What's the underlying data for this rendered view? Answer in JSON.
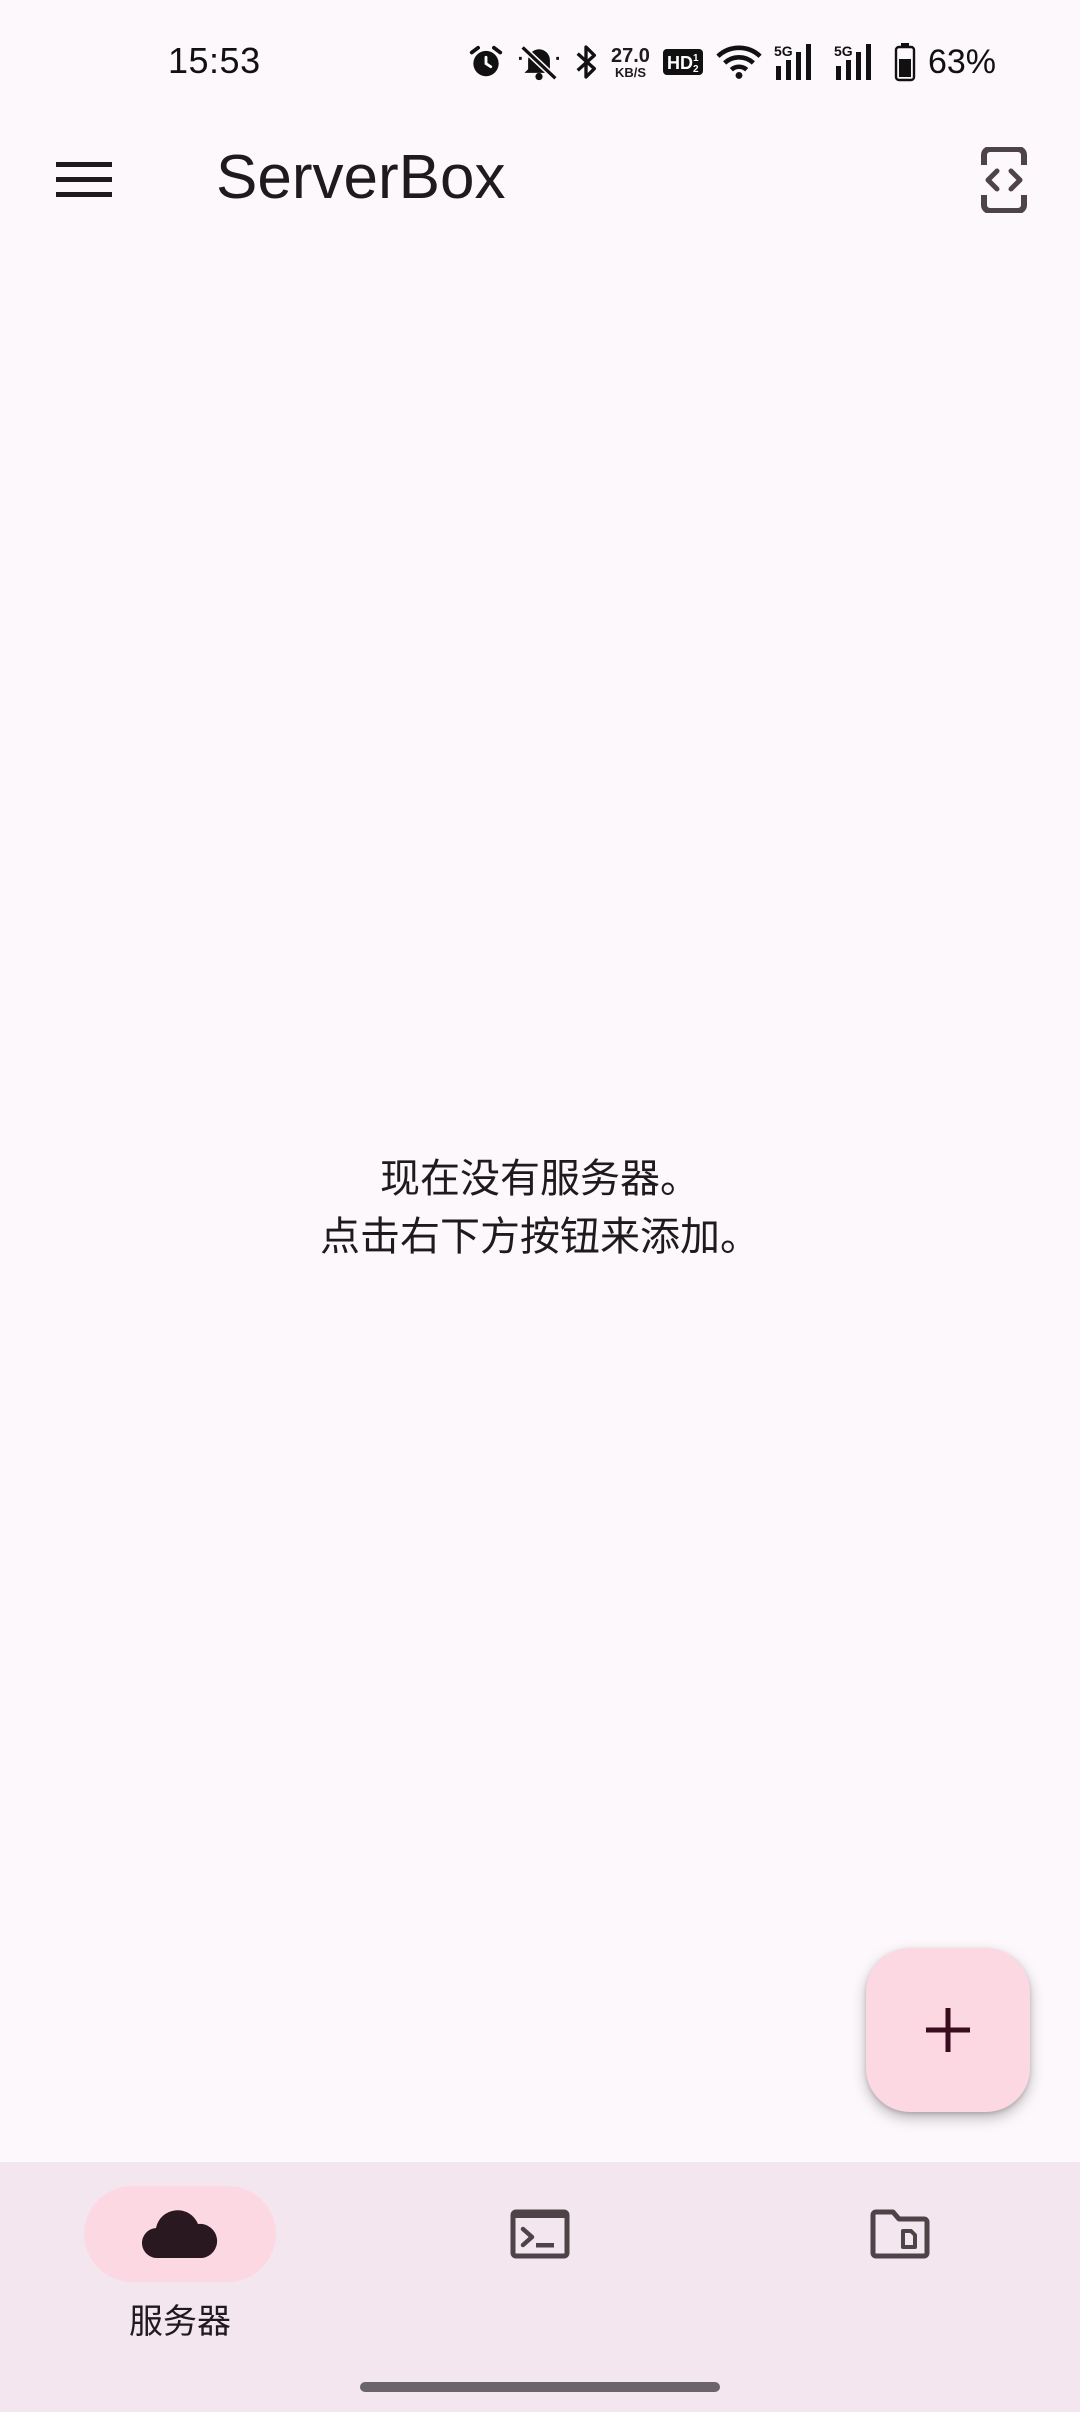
{
  "status_bar": {
    "time": "15:53",
    "speed_value": "27.0",
    "speed_unit": "KB/S",
    "hd_label": "HD",
    "network_1": "5G",
    "network_2": "5G",
    "battery": "63%",
    "icons": [
      "alarm-icon",
      "mute-icon",
      "bluetooth-icon",
      "hd-voice-icon",
      "wifi-icon",
      "signal-icon",
      "battery-icon"
    ]
  },
  "app_bar": {
    "title": "ServerBox",
    "menu_icon": "menu-icon",
    "action_icon": "developer-mode-icon"
  },
  "empty_state": {
    "line1": "现在没有服务器。",
    "line2": "点击右下方按钮来添加。"
  },
  "fab": {
    "icon": "plus-icon"
  },
  "bottom_nav": {
    "items": [
      {
        "label": "服务器",
        "icon": "cloud-icon",
        "selected": true
      },
      {
        "label": "",
        "icon": "terminal-icon",
        "selected": false
      },
      {
        "label": "",
        "icon": "folder-icon",
        "selected": false
      }
    ]
  },
  "colors": {
    "background": "#fdf8fb",
    "fab": "#fcd9e2",
    "nav_background": "#f4e6ee",
    "nav_active_pill": "#fcd9e2",
    "text": "#1f1a1d"
  }
}
